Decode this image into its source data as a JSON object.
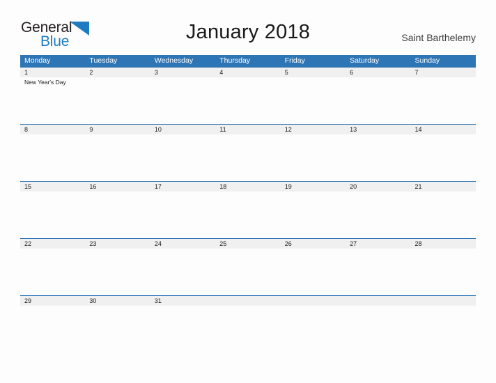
{
  "brand": {
    "name_part1": "General",
    "name_part2": "Blue",
    "flag_icon": "blue-triangle-flag",
    "color_dark": "#231f20",
    "color_blue": "#1f7bc1"
  },
  "header": {
    "title": "January 2018",
    "location": "Saint Barthelemy"
  },
  "theme": {
    "header_blue": "#2e75b6",
    "date_band_gray": "#f0f0f0",
    "page_background": "#fdfdfd",
    "text_dark": "#1a1a1a"
  },
  "calendar": {
    "month": "January",
    "year": "2018",
    "weekday_headers": [
      "Monday",
      "Tuesday",
      "Wednesday",
      "Thursday",
      "Friday",
      "Saturday",
      "Sunday"
    ],
    "weeks": [
      {
        "dates": [
          "1",
          "2",
          "3",
          "4",
          "5",
          "6",
          "7"
        ],
        "events": [
          "New Year's Day",
          "",
          "",
          "",
          "",
          "",
          ""
        ]
      },
      {
        "dates": [
          "8",
          "9",
          "10",
          "11",
          "12",
          "13",
          "14"
        ],
        "events": [
          "",
          "",
          "",
          "",
          "",
          "",
          ""
        ]
      },
      {
        "dates": [
          "15",
          "16",
          "17",
          "18",
          "19",
          "20",
          "21"
        ],
        "events": [
          "",
          "",
          "",
          "",
          "",
          "",
          ""
        ]
      },
      {
        "dates": [
          "22",
          "23",
          "24",
          "25",
          "26",
          "27",
          "28"
        ],
        "events": [
          "",
          "",
          "",
          "",
          "",
          "",
          ""
        ]
      },
      {
        "dates": [
          "29",
          "30",
          "31",
          "",
          "",
          "",
          ""
        ],
        "events": [
          "",
          "",
          "",
          "",
          "",
          "",
          ""
        ]
      }
    ]
  }
}
